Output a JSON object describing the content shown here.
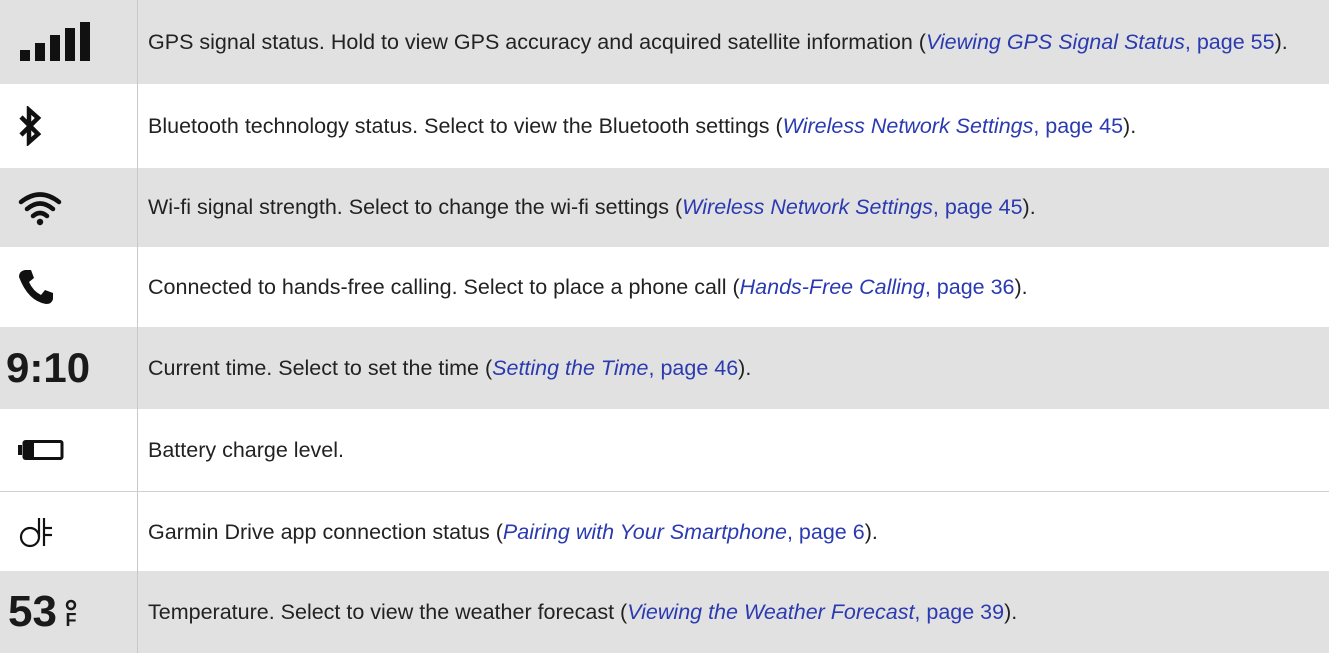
{
  "rows": [
    {
      "icon": "signal-bars-icon",
      "pre": "GPS signal status. Hold to view GPS accuracy and acquired satellite information (",
      "ref": "Viewing GPS Signal Status",
      "page": ", page 55",
      "post": ")."
    },
    {
      "icon": "bluetooth-icon",
      "pre": "Bluetooth technology status. Select to view the Bluetooth settings (",
      "ref": "Wireless Network Settings",
      "page": ", page 45",
      "post": ")."
    },
    {
      "icon": "wifi-icon",
      "pre": "Wi-fi signal strength. Select to change the wi-fi settings (",
      "ref": "Wireless Network Settings",
      "page": ", page 45",
      "post": ")."
    },
    {
      "icon": "phone-icon",
      "pre": "Connected to hands-free calling. Select to place a phone call (",
      "ref": "Hands-Free Calling",
      "page": ", page 36",
      "post": ")."
    },
    {
      "icon_text": "9:10",
      "pre": "Current time. Select to set the time (",
      "ref": "Setting the Time",
      "page": ", page 46",
      "post": ")."
    },
    {
      "icon": "battery-icon",
      "text": "Battery charge level."
    },
    {
      "icon": "garmin-drive-icon",
      "pre": "Garmin Drive app connection status (",
      "ref": "Pairing with Your Smartphone",
      "page": ", page 6",
      "post": ")."
    },
    {
      "icon_text": "53",
      "icon_unit": "F",
      "pre": "Temperature. Select to view the weather forecast (",
      "ref": "Viewing the Weather Forecast",
      "page": ", page 39",
      "post": ")."
    }
  ]
}
